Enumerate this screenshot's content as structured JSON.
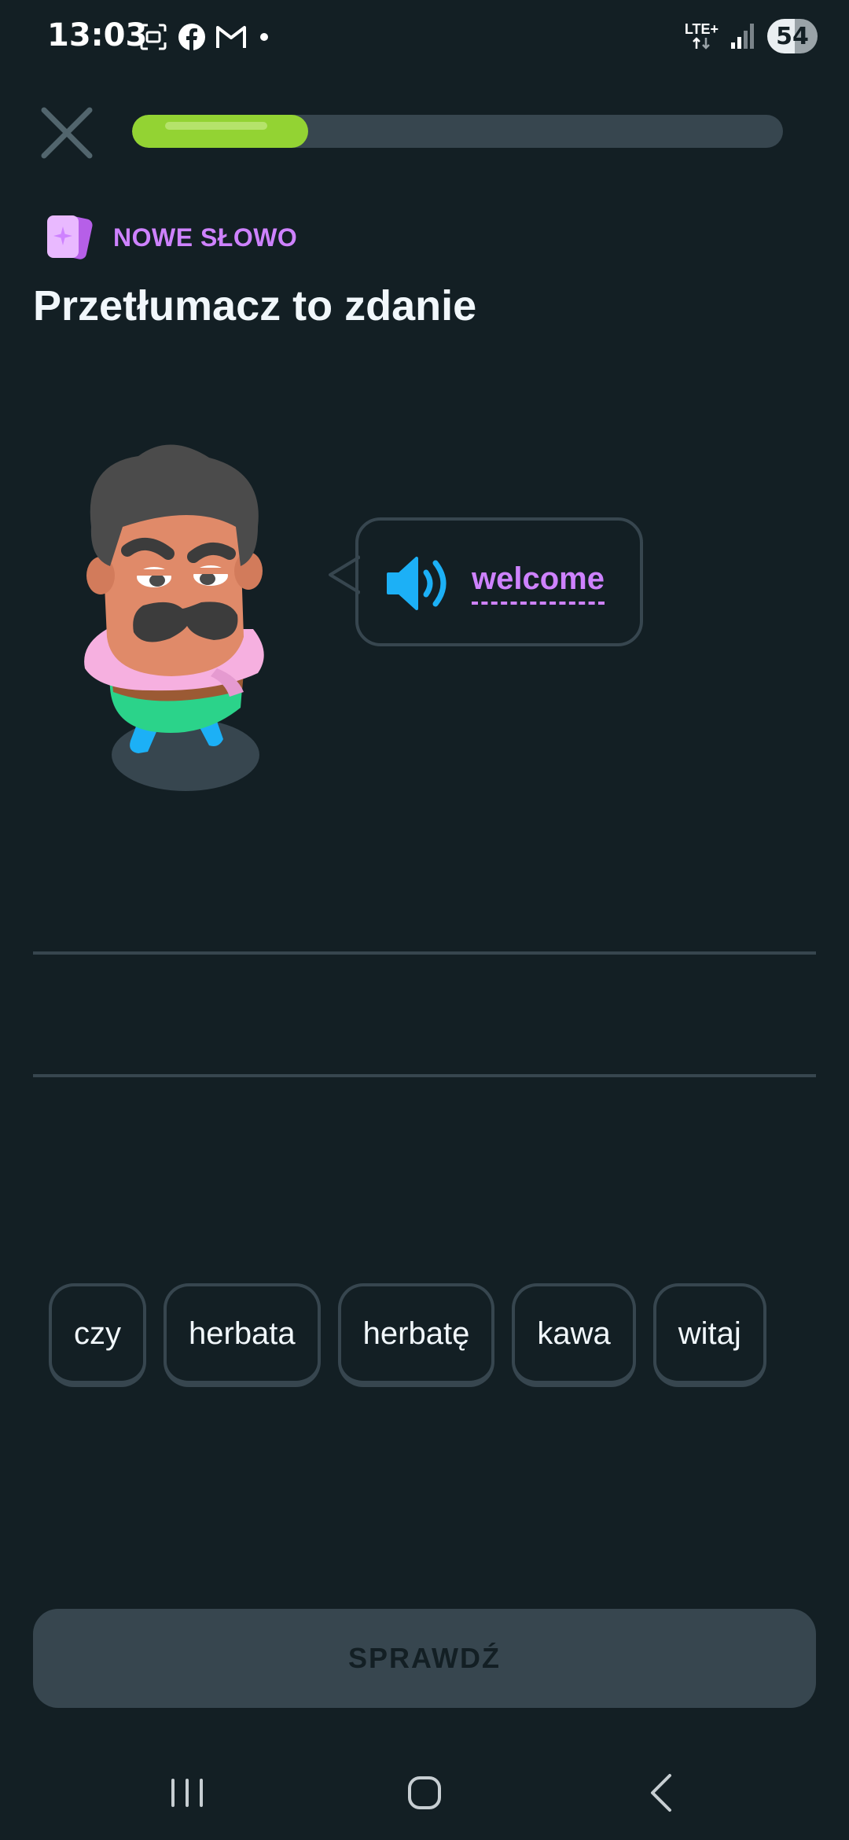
{
  "status_bar": {
    "time": "13:03",
    "network": "LTE+",
    "battery": "54",
    "left_icons": [
      "screenshot-icon",
      "facebook-icon",
      "gmail-icon",
      "dot-icon"
    ]
  },
  "lesson": {
    "progress": 0.27,
    "badge_label": "NOWE SŁOWO",
    "title": "Przetłumacz to zdanie",
    "prompt_word": "welcome"
  },
  "word_bank": [
    "czy",
    "herbata",
    "herbatę",
    "kawa",
    "witaj"
  ],
  "check_button_label": "SPRAWDŹ",
  "colors": {
    "background": "#131f24",
    "accent_purple": "#ce82ff",
    "progress_green": "#93d333",
    "speaker_blue": "#1cb0f6",
    "border": "#37464f"
  }
}
